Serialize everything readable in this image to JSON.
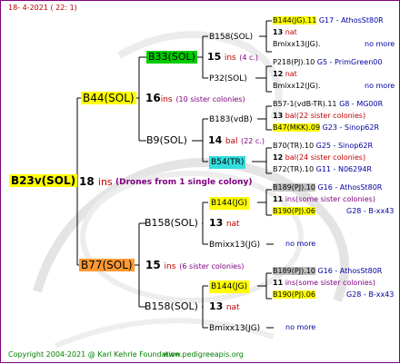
{
  "header": {
    "date": "18-  4-2021  ( 22:  1)"
  },
  "root": {
    "name": "B23v(SOL)",
    "ins_num": "18",
    "ins_label": "ins",
    "note": "(Drones from 1 single colony)"
  },
  "g1": {
    "upper": {
      "name": "B44(SOL)",
      "ins_num": "16",
      "ins_label": "ins",
      "note": "(10 sister colonies)"
    },
    "lower": {
      "name": "B77(SOL)",
      "ins_num": "15",
      "ins_label": "ins",
      "note": "(6 sister colonies)"
    }
  },
  "g2": {
    "b33": {
      "name": "B33(SOL)",
      "ins_num": "15",
      "ins_label": "ins",
      "note": "(4 c.)"
    },
    "b9": {
      "name": "B9(SOL)",
      "ins_num": "14",
      "ins_label": "bal",
      "note": "(22 c.)"
    },
    "b158a": {
      "name": "B158(SOL)",
      "ins_num": "13",
      "ins_label": "nat"
    },
    "b158b": {
      "name": "B158(SOL)",
      "ins_num": "13",
      "ins_label": "nat"
    }
  },
  "g3": [
    {
      "name": "B158(SOL)"
    },
    {
      "name": "P32(SOL)"
    },
    {
      "name": "B183(vdB)"
    },
    {
      "name": "B54(TR)"
    },
    {
      "name": "B144(JG)"
    },
    {
      "name": "Bmixx13(JG)"
    },
    {
      "name": "B144(JG)"
    },
    {
      "name": "Bmixx13(JG)"
    }
  ],
  "g4": {
    "b1": {
      "top": {
        "name": "B144(JG).11",
        "ref": "G17 - AthosSt80R"
      },
      "mid": {
        "num": "13",
        "label": "nat"
      },
      "bot": {
        "name": "Bmixx13(JG).",
        "ref": "no more"
      }
    },
    "b2": {
      "top": {
        "name": "P218(PJ).10",
        "ref": "G5 - PrimGreen00"
      },
      "mid": {
        "num": "12",
        "label": "nat"
      },
      "bot": {
        "name": "Bmixx12(JG).",
        "ref": "no more"
      }
    },
    "b3": {
      "top": {
        "name": "B57-1(vdB-TR).11",
        "ref": "G8 - MG00R"
      },
      "mid": {
        "num": "13",
        "label": "bal(22 sister colonies)"
      },
      "bot": {
        "name": "B47(MKK).09",
        "ref": "G23 - Sinop62R"
      }
    },
    "b4": {
      "top": {
        "name": "B70(TR).10",
        "ref": "G25 - Sinop62R"
      },
      "mid": {
        "num": "12",
        "label": "bal(24 sister colonies)"
      },
      "bot": {
        "name": "B72(TR).10",
        "ref": "G11 - N06294R"
      }
    },
    "b5": {
      "top": {
        "name": "B189(PJ).10",
        "ref": "G16 - AthosSt80R"
      },
      "mid": {
        "num": "11",
        "label": "ins(some sister colonies)"
      },
      "bot": {
        "name": "B190(PJ).06",
        "ref": "G28 - B-xx43"
      }
    },
    "b6": {
      "text": "no more"
    },
    "b7": {
      "top": {
        "name": "B189(PJ).10",
        "ref": "G16 - AthosSt80R"
      },
      "mid": {
        "num": "11",
        "label": "ins(some sister colonies)"
      },
      "bot": {
        "name": "B190(PJ).06",
        "ref": "G28 - B-xx43"
      }
    },
    "b8": {
      "text": "no more"
    }
  },
  "footer": {
    "copyright": "Copyright 2004-2021 @ Karl Kehrle Foundation",
    "site": "www.pedigreeapis.org"
  }
}
